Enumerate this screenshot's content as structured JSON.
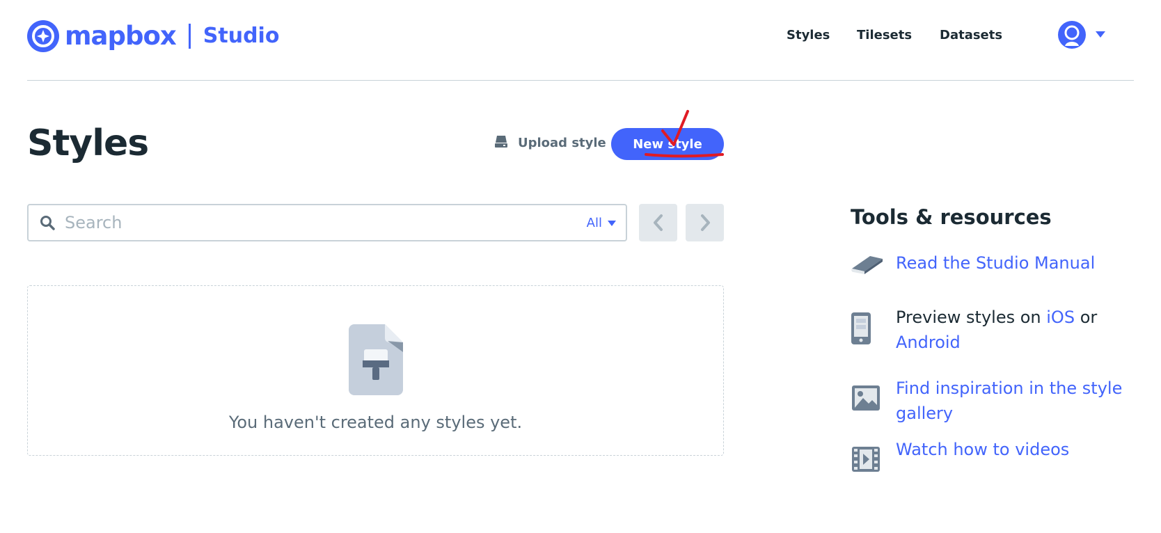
{
  "header": {
    "logo_word": "mapbox",
    "logo_product": "Studio",
    "nav": [
      {
        "label": "Styles"
      },
      {
        "label": "Tilesets"
      },
      {
        "label": "Datasets"
      }
    ]
  },
  "page": {
    "title": "Styles",
    "upload_label": "Upload style",
    "new_style_label": "New style"
  },
  "search": {
    "placeholder": "Search",
    "value": "",
    "filter_label": "All"
  },
  "empty_state": {
    "message": "You haven't created any styles yet."
  },
  "tools": {
    "title": "Tools & resources",
    "manual": "Read the Studio Manual",
    "preview_prefix": "Preview styles on ",
    "preview_ios": "iOS",
    "preview_or": " or ",
    "preview_android": "Android",
    "gallery": "Find inspiration in the style gallery",
    "videos": "Watch how to videos"
  },
  "colors": {
    "brand": "#4264fb",
    "text": "#1b2a33",
    "muted": "#5a6b78",
    "border": "#c8d2d8",
    "annotation": "#e01b24"
  },
  "icons": [
    "compass-logo-icon",
    "avatar-icon",
    "chevron-down-icon",
    "upload-icon",
    "search-icon",
    "chevron-left-icon",
    "chevron-right-icon",
    "style-file-icon",
    "book-icon",
    "phone-icon",
    "image-icon",
    "film-icon"
  ]
}
